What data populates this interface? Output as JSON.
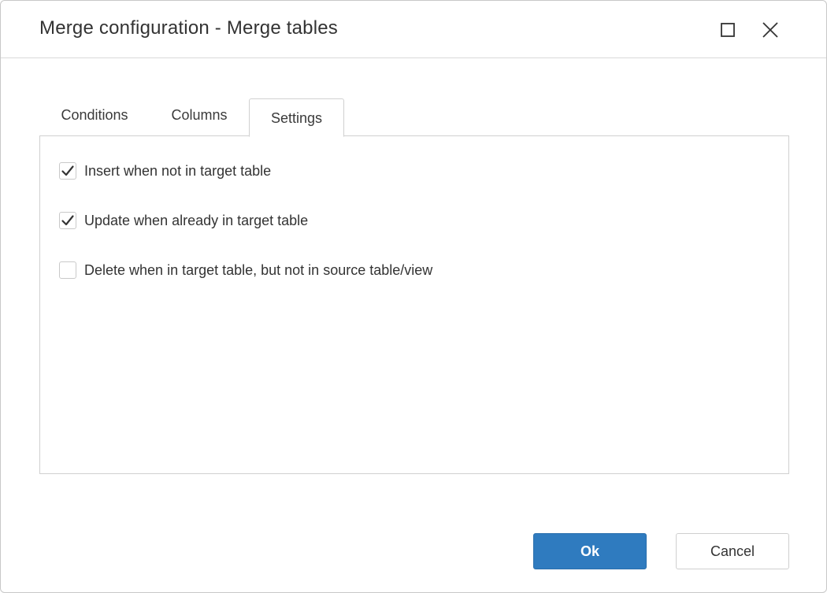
{
  "dialog": {
    "title": "Merge configuration - Merge tables"
  },
  "window_controls": {
    "maximize_icon": "maximize-icon",
    "close_icon": "close-icon"
  },
  "tabs": [
    {
      "label": "Conditions",
      "active": false
    },
    {
      "label": "Columns",
      "active": false
    },
    {
      "label": "Settings",
      "active": true
    }
  ],
  "settings": {
    "options": [
      {
        "label": "Insert when not in target table",
        "checked": true
      },
      {
        "label": "Update when already in target table",
        "checked": true
      },
      {
        "label": "Delete when in target table, but not in source table/view",
        "checked": false
      }
    ]
  },
  "footer": {
    "ok_label": "Ok",
    "cancel_label": "Cancel"
  },
  "colors": {
    "primary_button": "#2f7bbf",
    "checkmark": "#333333",
    "border": "#d0d0d0"
  }
}
